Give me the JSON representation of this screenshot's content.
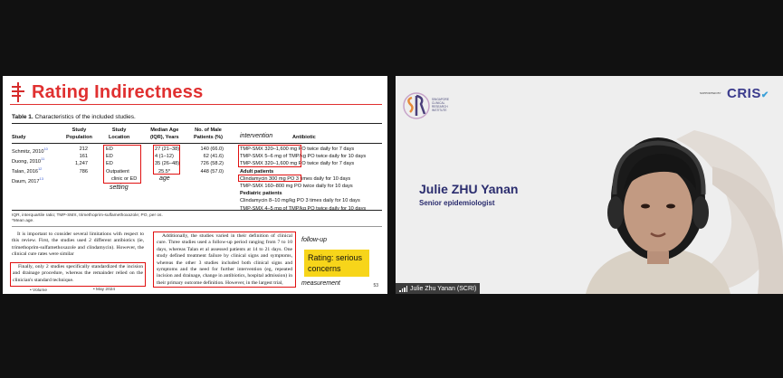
{
  "slide": {
    "title": "Rating Indirectness",
    "table_caption_bold": "Table 1.",
    "table_caption_text": "Characteristics of the included studies.",
    "headers": {
      "study": "Study",
      "population": "Study\nPopulation",
      "location": "Study\nLocation",
      "median_age": "Median Age\n(IQR), Years",
      "male": "No. of Male\nPatients (%)",
      "intervention": "intervention",
      "antibiotic": "Antibiotic"
    },
    "rows": [
      {
        "study": "Schmitz, 2010",
        "ref": "10",
        "population": "212",
        "location": "ED",
        "age": "27 (21–38)",
        "male": "140 (66.0)",
        "antibiotic": "TMP-SMX 320–1,600 mg PO twice daily for 7 days"
      },
      {
        "study": "Duong, 2010",
        "ref": "11",
        "population": "161",
        "location": "ED",
        "age": "4 (1–12)",
        "male": "62 (41.6)",
        "antibiotic": "TMP-SMX 5–6 mg of TMP/kg PO twice daily for 10 days"
      },
      {
        "study": "Talan, 2016",
        "ref": "12",
        "population": "1,247",
        "location": "ED",
        "age": "35 (26–48)",
        "male": "726 (58.2)",
        "antibiotic": "TMP-SMX 320–1,600 mg PO twice daily for 7 days"
      },
      {
        "study": "Daum, 2017",
        "ref": "13",
        "population": "786",
        "location": "Outpatient",
        "location2": "clinic or ED",
        "age": "25.5*",
        "male": "448 (57.0)",
        "antibiotic_header": "Adult patients"
      }
    ],
    "extra_antibiotic_lines": [
      "Clindamycin 300 mg PO 3 times daily for 10 days",
      "TMP-SMX 160–800 mg PO twice daily for 10 days",
      "Pediatric patients",
      "Clindamycin 8–10 mg/kg PO 3 times daily for 10 days",
      "TMP-SMX 4–5 mg of TMP/kg PO twice daily for 10 days"
    ],
    "annotations": {
      "setting": "setting",
      "age": "age",
      "follow_up": "follow-up",
      "measurement": "measurement"
    },
    "footnotes": [
      "IQR, interquartile ratio; TMP-SMX, trimethoprim-sulfamethoxazole; PO, per os.",
      "*Mean age."
    ],
    "para_left": "It is important to consider several limitations with respect to this review. First, the studies used 2 different antibiotics (ie, trimethoprim-sulfamethoxazole and clindamycin). However, the clinical cure rates were similar",
    "para_left_boxed": "Finally, only 2 studies specifically standardized the incision and drainage procedure, whereas the remainder relied on the clinician's standard technique.",
    "para_right": "Additionally, the studies varied in their definition of clinical cure. Three studies used a follow-up period ranging from 7 to 10 days, whereas Talan et al assessed patients at 14 to 21 days. One study defined treatment failure by clinical signs and symptoms, whereas the other 3 studies included both clinical signs and symptoms and the need for further intervention (eg, repeated incision and drainage, change in antibiotics, hospital admission) in their primary outcome definition. However, in the largest trial,",
    "rating_text": "Rating: serious concerns",
    "page_number": "53",
    "footer_left": "• Volume",
    "footer_mid": "• May 2024"
  },
  "video": {
    "sri_lines": [
      "SINGAPORE",
      "CLINICAL",
      "RESEARCH",
      "INSTITUTE"
    ],
    "supported_by": "SUPPORTED BY",
    "cris": "CRIS",
    "speaker_name": "Julie ZHU Yanan",
    "speaker_title": "Senior epidemiologist",
    "participant_label": "Julie Zhu Yanan (SCRI)"
  },
  "colors": {
    "accent_red": "#e03030",
    "rating_yellow": "#f7d51a",
    "brand_navy": "#2a2c6e"
  }
}
